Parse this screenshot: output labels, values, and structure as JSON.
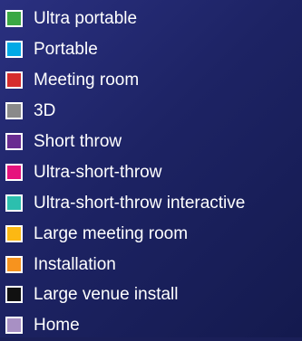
{
  "legend": {
    "items": [
      {
        "label": "Ultra portable",
        "color": "#3aa843"
      },
      {
        "label": "Portable",
        "color": "#00a9e6"
      },
      {
        "label": "Meeting room",
        "color": "#d62c2c"
      },
      {
        "label": "3D",
        "color": "#8a8a8a"
      },
      {
        "label": "Short throw",
        "color": "#6a2c91"
      },
      {
        "label": "Ultra-short-throw",
        "color": "#e6137d"
      },
      {
        "label": "Ultra-short-throw interactive",
        "color": "#2cbfae"
      },
      {
        "label": "Large meeting room",
        "color": "#fcb813"
      },
      {
        "label": "Installation",
        "color": "#f7931e"
      },
      {
        "label": "Large venue install",
        "color": "#111111"
      },
      {
        "label": "Home",
        "color": "#a890c4"
      }
    ]
  }
}
